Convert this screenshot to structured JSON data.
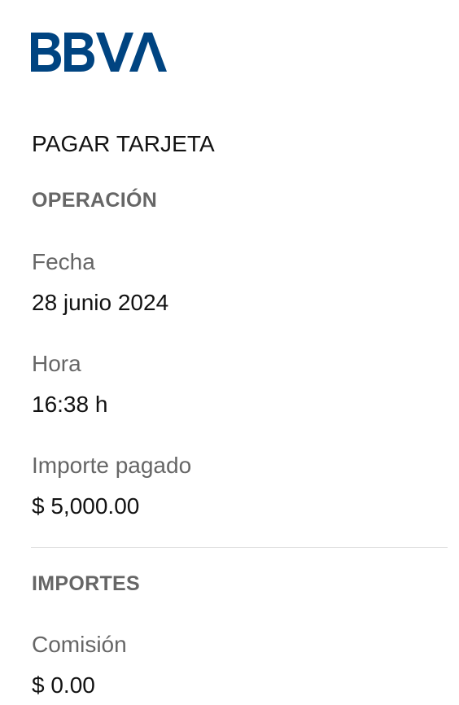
{
  "brand": {
    "logo_text": "BBVA",
    "color": "#004481"
  },
  "page": {
    "title": "PAGAR TARJETA"
  },
  "operation": {
    "heading": "OPERACIÓN",
    "date_label": "Fecha",
    "date_value": "28 junio 2024",
    "time_label": "Hora",
    "time_value": "16:38 h",
    "amount_label": "Importe pagado",
    "amount_value": "$ 5,000.00"
  },
  "amounts": {
    "heading": "IMPORTES",
    "fee_label": "Comisión",
    "fee_value": "$ 0.00"
  }
}
